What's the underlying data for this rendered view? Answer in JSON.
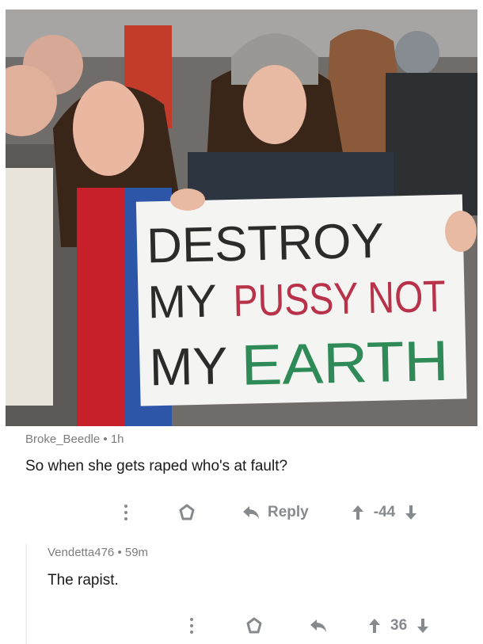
{
  "photo": {
    "sign": {
      "line1": "DESTROY",
      "line2_a": "MY",
      "line2_b": "PUSSY NOT",
      "line3_a": "MY",
      "line3_b": "EARTH"
    },
    "colors": {
      "black_text": "#2b2b2b",
      "red_text": "#b8324a",
      "green_text": "#2e8b57",
      "sign_bg": "#f4f4f2"
    }
  },
  "comments": [
    {
      "author": "Broke_Beedle",
      "age": "1h",
      "text": "So when she gets raped who's at fault?",
      "reply_label": "Reply",
      "score": "-44"
    },
    {
      "author": "Vendetta476",
      "age": "59m",
      "text": "The rapist.",
      "score": "36"
    }
  ],
  "icons": {
    "more": "vertical-dots-icon",
    "save": "shield-icon",
    "reply": "reply-arrow-icon",
    "upvote": "up-arrow-icon",
    "downvote": "down-arrow-icon"
  },
  "separator": "•"
}
